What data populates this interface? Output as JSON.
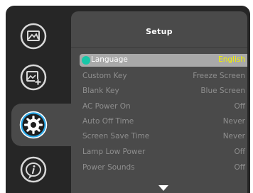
{
  "panel": {
    "title": "Setup"
  },
  "tabs": [
    {
      "name": "image-icon"
    },
    {
      "name": "advanced-image-icon"
    },
    {
      "name": "setup-gear-icon",
      "active": true
    },
    {
      "name": "status-info-icon"
    }
  ],
  "items": [
    {
      "label": "Language",
      "value": "English",
      "selected": true
    },
    {
      "label": "Custom Key",
      "value": "Freeze Screen"
    },
    {
      "label": "Blank Key",
      "value": "Blue Screen"
    },
    {
      "label": "AC Power On",
      "value": "Off"
    },
    {
      "label": "Auto Off Time",
      "value": "Never"
    },
    {
      "label": "Screen Save Time",
      "value": "Never"
    },
    {
      "label": "Lamp Low Power",
      "value": "Off"
    },
    {
      "label": "Power Sounds",
      "value": "Off"
    }
  ],
  "colors": {
    "frame": "#262626",
    "panel": "#4a4a4a",
    "selected_row": "#a9a9a9",
    "selected_value": "#f2f200",
    "accent_icon": "#18c7a8"
  },
  "icons": [
    "image-icon",
    "advanced-image-icon",
    "setup-gear-icon",
    "status-info-icon",
    "language-globe-icon",
    "scroll-down-arrow-icon"
  ]
}
